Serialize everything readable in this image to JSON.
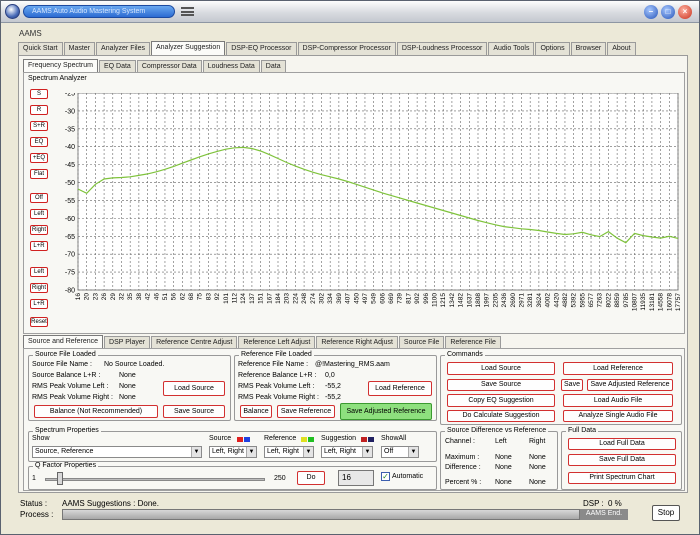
{
  "window": {
    "title": "AAMS Auto Audio Mastering System",
    "app_name": "AAMS"
  },
  "main_tabs": [
    "Quick Start",
    "Master",
    "Analyzer Files",
    "Analyzer Suggestion",
    "DSP-EQ Processor",
    "DSP-Compressor Processor",
    "DSP-Loudness Processor",
    "Audio Tools",
    "Options",
    "Browser",
    "About"
  ],
  "sub_tabs": [
    "Frequency Spectrum",
    "EQ Data",
    "Compressor Data",
    "Loudness Data",
    "Data"
  ],
  "analyzer": {
    "title": "Spectrum Analyzer"
  },
  "side_buttons": [
    "S",
    "R",
    "S+R",
    "EQ",
    "+EQ",
    "Flat",
    "Off",
    "Left",
    "Right",
    "L+R",
    "Left",
    "Right",
    "L+R",
    "Reset"
  ],
  "chart_data": {
    "type": "line",
    "title": "",
    "xlabel": "",
    "ylabel": "",
    "y_ticks": [
      -25,
      -30,
      -35,
      -40,
      -45,
      -50,
      -55,
      -60,
      -65,
      -70,
      -75,
      -80
    ],
    "ylim": [
      -80,
      -25
    ],
    "x_ticks": [
      "16",
      "20",
      "23",
      "26",
      "29",
      "32",
      "35",
      "38",
      "42",
      "46",
      "51",
      "56",
      "62",
      "68",
      "75",
      "83",
      "92",
      "101",
      "112",
      "124",
      "137",
      "151",
      "167",
      "184",
      "203",
      "224",
      "248",
      "274",
      "302",
      "334",
      "369",
      "407",
      "450",
      "497",
      "549",
      "606",
      "669",
      "739",
      "817",
      "902",
      "996",
      "1100",
      "1215",
      "1342",
      "1482",
      "1637",
      "1808",
      "1997",
      "2205",
      "2436",
      "2690",
      "2971",
      "3281",
      "3624",
      "4002",
      "4420",
      "4882",
      "5392",
      "5955",
      "6577",
      "7263",
      "8022",
      "8859",
      "9785",
      "10807",
      "11935",
      "13181",
      "14558",
      "16078",
      "17757"
    ],
    "grid": true,
    "legend": "none",
    "series": [
      {
        "color": "#7fc33c",
        "values": [
          -51.8,
          -53,
          -50.5,
          -49,
          -48.7,
          -48.6,
          -48.4,
          -48,
          -47.6,
          -47,
          -46.3,
          -45.5,
          -44.6,
          -43.7,
          -42.8,
          -42,
          -41.3,
          -40.7,
          -40.3,
          -40.2,
          -40.5,
          -41.2,
          -42.2,
          -43.3,
          -44.4,
          -45.4,
          -46.3,
          -47.1,
          -47.8,
          -48.4,
          -49,
          -49.7,
          -50.5,
          -51.3,
          -52.1,
          -52.9,
          -53.6,
          -54.3,
          -55,
          -55.7,
          -56.4,
          -57.1,
          -57.8,
          -58.5,
          -59.2,
          -59.9,
          -60.6,
          -61.2,
          -61.8,
          -62.3,
          -62.6,
          -62.9,
          -63.1,
          -63.4,
          -63.8,
          -64.2,
          -64.5,
          -64.3,
          -63.9,
          -64.6,
          -65.1,
          -63.7,
          -65.5,
          -66.8,
          -64.2,
          -64.8,
          -65.2,
          -65.5,
          -65,
          -65.6
        ]
      }
    ]
  },
  "bottom_tabs": [
    "Source and Reference",
    "DSP Player",
    "Reference Centre Adjust",
    "Reference Left Adjust",
    "Reference Right Adjust",
    "Source File",
    "Reference File"
  ],
  "source": {
    "group_label": "Source File Loaded",
    "name_label": "Source File Name :",
    "name_value": "No Source Loaded.",
    "balance_label": "Source Balance L+R :",
    "balance_value": "None",
    "peak_left_label": "RMS Peak Volume   Left :",
    "peak_left_value": "None",
    "peak_right_label": "RMS Peak Volume   Right :",
    "peak_right_value": "None",
    "load_btn": "Load Source",
    "balance_btn": "Balance (Not Recommended)",
    "save_btn": "Save Source"
  },
  "reference": {
    "group_label": "Reference File Loaded",
    "name_label": "Reference File Name :",
    "name_value": "@!Mastering_RMS.aam",
    "balance_label": "Reference  Balance L+R :",
    "balance_value": "0,0",
    "peak_left_label": "RMS Peak Volume   Left :",
    "peak_left_value": "-55,2",
    "peak_right_label": "RMS Peak Volume   Right :",
    "peak_right_value": "-55,2",
    "load_btn": "Load Reference",
    "balance_btn": "Balance",
    "save_btn": "Save Reference",
    "save_adj_btn": "Save Adjusted Reference"
  },
  "commands": {
    "group_label": "Commands",
    "load_source": "Load Source",
    "load_reference": "Load Reference",
    "save_source": "Save Source",
    "save": "Save",
    "save_adjusted": "Save Adjusted Reference",
    "copy_eq": "Copy EQ Suggestion",
    "load_audio": "Load Audio File",
    "do_calc": "Do Calculate Suggestion",
    "analyze_single": "Analyze Single Audio File"
  },
  "spectrum_props": {
    "group_label": "Spectrum Properties",
    "show_label": "Show",
    "show_value": "Source, Reference",
    "source_label": "Source",
    "source_value": "Left, Right",
    "reference_label": "Reference",
    "reference_value": "Left, Right",
    "suggestion_label": "Suggestion",
    "suggestion_value": "Left, Right",
    "showall_label": "ShowAll",
    "showall_value": "Off",
    "source_colors": [
      "#e02020",
      "#2040e0"
    ],
    "reference_colors": [
      "#e0e020",
      "#20c020"
    ],
    "suggestion_colors": [
      "#c02020",
      "#202060"
    ]
  },
  "qfactor": {
    "group_label": "Q Factor Properties",
    "min": "1",
    "max": "250",
    "do_btn": "Do",
    "value": "16",
    "automatic_label": "Automatic",
    "automatic_checked": true
  },
  "source_diff": {
    "group_label": "Source Difference vs Reference",
    "channel_label": "Channel :",
    "left_header": "Left",
    "right_header": "Right",
    "maximum_label": "Maximum :",
    "maximum_left": "None",
    "maximum_right": "None",
    "difference_label": "Difference :",
    "difference_left": "None",
    "difference_right": "None",
    "percent_label": "Percent % :",
    "percent_left": "None",
    "percent_right": "None"
  },
  "full_data": {
    "group_label": "Full Data",
    "load_btn": "Load Full Data",
    "save_btn": "Save Full Data",
    "print_btn": "Print Spectrum Chart"
  },
  "status": {
    "status_label": "Status :",
    "status_value": "AAMS Suggestions : Done.",
    "process_label": "Process :",
    "dsp_label": "DSP :",
    "dsp_value": "0 %",
    "end_label": "AAMS End.",
    "stop_btn": "Stop"
  }
}
